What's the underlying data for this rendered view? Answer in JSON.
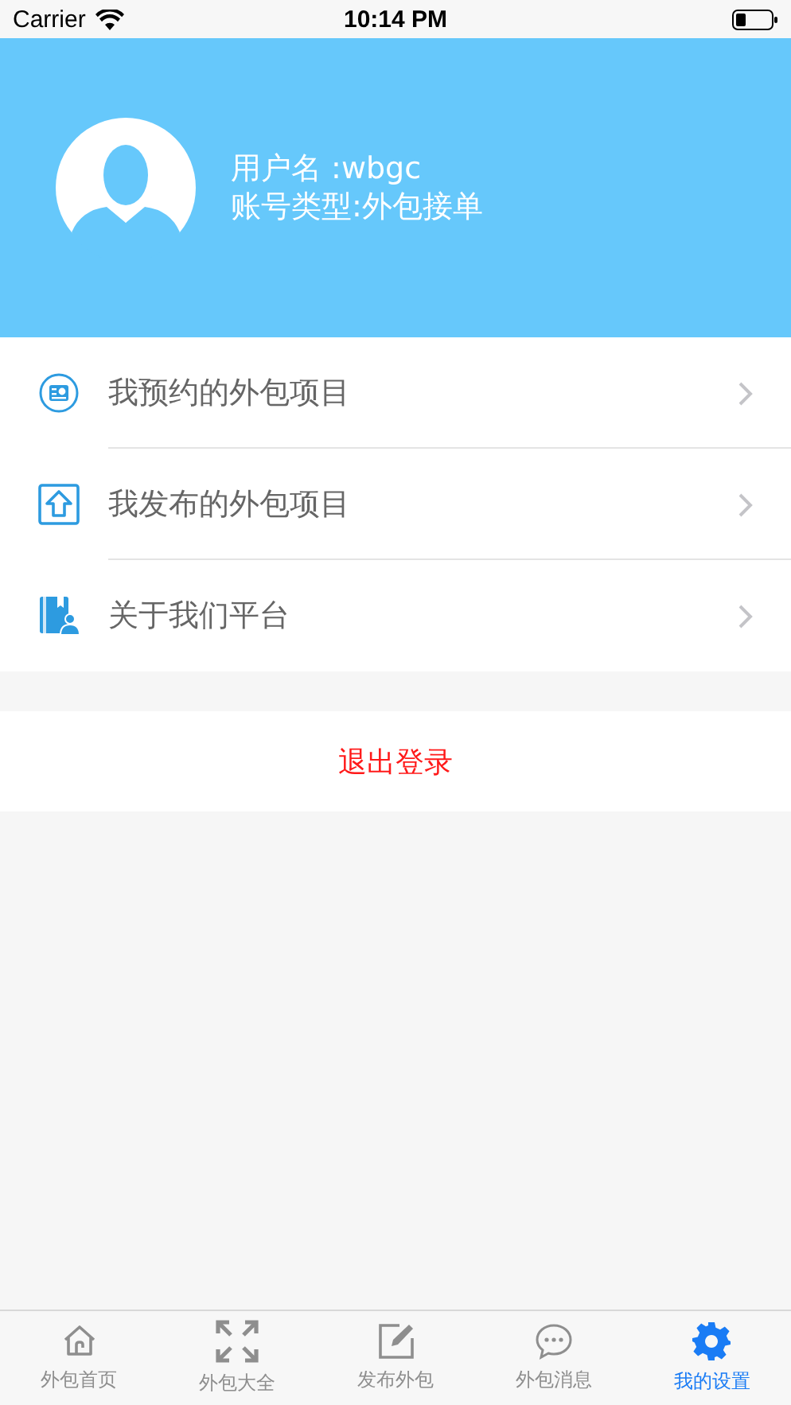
{
  "status_bar": {
    "carrier": "Carrier",
    "time": "10:14 PM"
  },
  "profile": {
    "username": "用户名 :wbgc",
    "account_type": "账号类型:外包接单"
  },
  "menu": [
    {
      "label": "我预约的外包项目",
      "kind": "booking"
    },
    {
      "label": "我发布的外包项目",
      "kind": "publish"
    },
    {
      "label": "关于我们平台",
      "kind": "about"
    }
  ],
  "logout": "退出登录",
  "tabs": [
    {
      "label": "外包首页",
      "kind": "home",
      "selected": false
    },
    {
      "label": "外包大全",
      "kind": "expand",
      "selected": false
    },
    {
      "label": "发布外包",
      "kind": "edit",
      "selected": false
    },
    {
      "label": "外包消息",
      "kind": "chat",
      "selected": false
    },
    {
      "label": "我的设置",
      "kind": "settings",
      "selected": true
    }
  ]
}
